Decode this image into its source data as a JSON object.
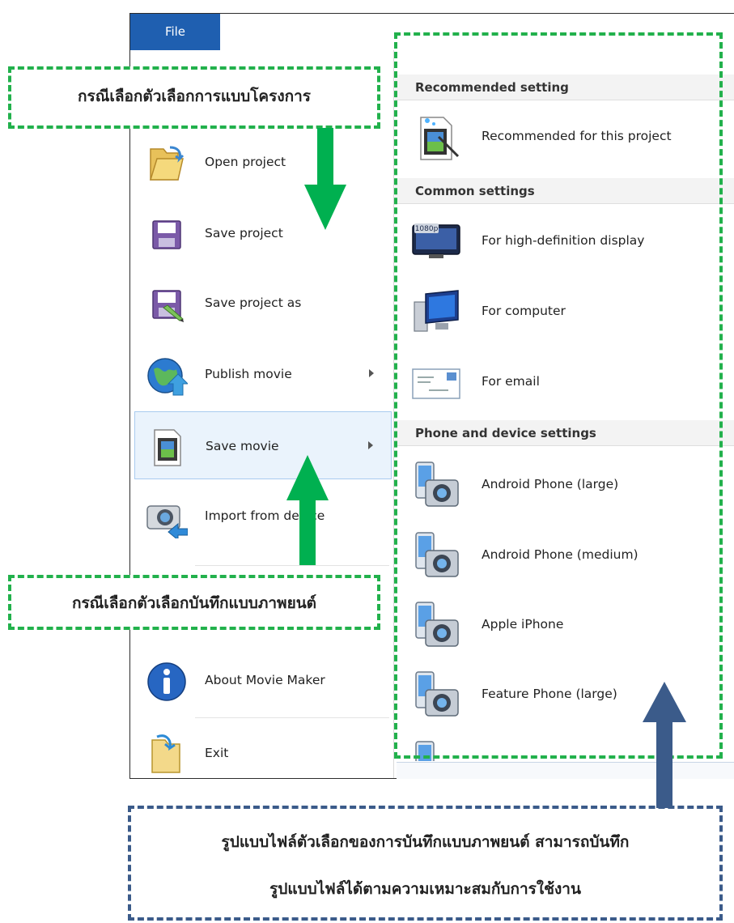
{
  "window": {
    "file_tab": "File"
  },
  "left_menu": {
    "items": [
      {
        "label": "Open project",
        "icon": "folder-open-icon",
        "has_submenu": false
      },
      {
        "label": "Save project",
        "icon": "floppy-disk-icon",
        "has_submenu": false
      },
      {
        "label": "Save project as",
        "icon": "floppy-disk-pencil-icon",
        "has_submenu": false
      },
      {
        "label": "Publish movie",
        "icon": "globe-upload-icon",
        "has_submenu": true
      },
      {
        "label": "Save movie",
        "icon": "film-document-icon",
        "has_submenu": true,
        "selected": true
      },
      {
        "label": "Import from device",
        "icon": "camera-import-icon",
        "has_submenu": false
      },
      {
        "label": "About Movie Maker",
        "icon": "info-icon",
        "has_submenu": false
      },
      {
        "label": "Exit",
        "icon": "exit-folder-icon",
        "has_submenu": false
      }
    ]
  },
  "save_movie_submenu": {
    "sections": [
      {
        "header": "Recommended setting",
        "options": [
          {
            "label": "Recommended for this project",
            "icon": "film-sparkle-icon"
          }
        ]
      },
      {
        "header": "Common settings",
        "options": [
          {
            "label": "For high-definition display",
            "icon": "hd-monitor-icon",
            "badge": "1080p"
          },
          {
            "label": "For computer",
            "icon": "computer-icon"
          },
          {
            "label": "For email",
            "icon": "envelope-icon"
          }
        ]
      },
      {
        "header": "Phone and device settings",
        "options": [
          {
            "label": "Android Phone (large)",
            "icon": "phone-camera-icon"
          },
          {
            "label": "Android Phone (medium)",
            "icon": "phone-camera-icon"
          },
          {
            "label": "Apple iPhone",
            "icon": "phone-camera-icon"
          },
          {
            "label": "Feature Phone (large)",
            "icon": "phone-camera-icon"
          }
        ]
      }
    ]
  },
  "annotations": {
    "project_note": "กรณีเลือกตัวเลือกการแบบโครงการ",
    "movie_note": "กรณีเลือกตัวเลือกบันทึกแบบภาพยนต์",
    "format_note_line1": "รูปแบบไฟล์ตัวเลือกของการบันทึกแบบภาพยนต์ สามารถบันทึก",
    "format_note_line2": "รูปแบบไฟล์ได้ตามความเหมาะสมกับการใช้งาน"
  },
  "colors": {
    "file_tab": "#1f5fb0",
    "annotation_green": "#22b14c",
    "annotation_blue": "#3b5b8a",
    "selection": "#eaf3fc"
  }
}
